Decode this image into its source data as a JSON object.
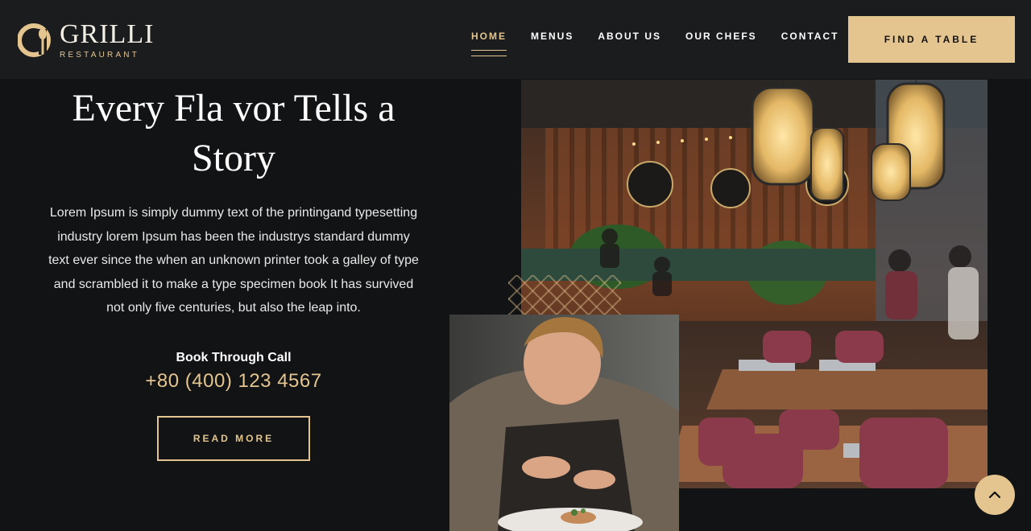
{
  "brand": {
    "name": "GRILLI",
    "tagline": "RESTAURANT",
    "accent": "#e4c590"
  },
  "nav": {
    "items": [
      {
        "label": "HOME",
        "active": true
      },
      {
        "label": "MENUS",
        "active": false
      },
      {
        "label": "ABOUT US",
        "active": false
      },
      {
        "label": "OUR CHEFS",
        "active": false
      },
      {
        "label": "CONTACT",
        "active": false
      }
    ],
    "cta_label": "FIND A TABLE"
  },
  "hero": {
    "title_line1": "Every Fla vor Tells a",
    "title_line2": "Story",
    "text": "Lorem Ipsum is simply dummy text of the printingand typesetting industry lorem Ipsum has been the industrys standard dummy text ever since the when an unknown printer took a galley of type and scrambled it to make a type specimen book It has survived not only five centuries, but also the leap into.",
    "book_label": "Book Through Call",
    "phone": "+80 (400) 123 4567",
    "read_more_label": "READ MORE"
  },
  "icons": {
    "logo": "grilli-logo-icon",
    "back_to_top": "chevron-up-icon"
  }
}
